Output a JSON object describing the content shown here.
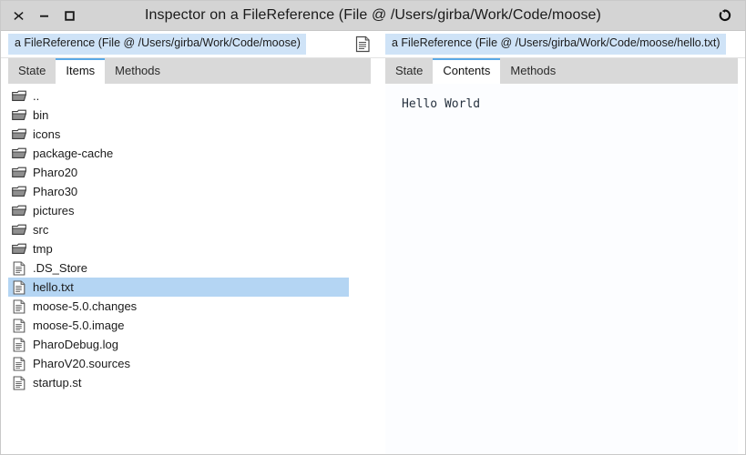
{
  "window": {
    "title": "Inspector on a FileReference (File @ /Users/girba/Work/Code/moose)",
    "controls": {
      "close_label": "✕",
      "minimize_label": "−",
      "maximize_label": "□",
      "close_icon": "close-icon",
      "minimize_icon": "minimize-icon",
      "maximize_icon": "maximize-icon",
      "history_icon": "refresh-history-icon"
    }
  },
  "breadcrumb": {
    "items": [
      {
        "label": "a FileReference (File @ /Users/girba/Work/Code/moose)"
      },
      {
        "label": "a FileReference (File @ /Users/girba/Work/Code/moose/hello.txt)"
      }
    ],
    "separator_icon": "document-icon"
  },
  "left_pane": {
    "tabs": [
      {
        "label": "State",
        "selected": false
      },
      {
        "label": "Items",
        "selected": true
      },
      {
        "label": "Methods",
        "selected": false
      }
    ],
    "items": [
      {
        "label": "..",
        "icon": "folder-icon",
        "type": "folder",
        "selected": false
      },
      {
        "label": "bin",
        "icon": "folder-icon",
        "type": "folder",
        "selected": false
      },
      {
        "label": "icons",
        "icon": "folder-icon",
        "type": "folder",
        "selected": false
      },
      {
        "label": "package-cache",
        "icon": "folder-icon",
        "type": "folder",
        "selected": false
      },
      {
        "label": "Pharo20",
        "icon": "folder-icon",
        "type": "folder",
        "selected": false
      },
      {
        "label": "Pharo30",
        "icon": "folder-icon",
        "type": "folder",
        "selected": false
      },
      {
        "label": "pictures",
        "icon": "folder-icon",
        "type": "folder",
        "selected": false
      },
      {
        "label": "src",
        "icon": "folder-icon",
        "type": "folder",
        "selected": false
      },
      {
        "label": "tmp",
        "icon": "folder-icon",
        "type": "folder",
        "selected": false
      },
      {
        "label": ".DS_Store",
        "icon": "file-icon",
        "type": "file",
        "selected": false
      },
      {
        "label": "hello.txt",
        "icon": "file-icon",
        "type": "file",
        "selected": true
      },
      {
        "label": "moose-5.0.changes",
        "icon": "file-icon",
        "type": "file",
        "selected": false
      },
      {
        "label": "moose-5.0.image",
        "icon": "file-icon",
        "type": "file",
        "selected": false
      },
      {
        "label": "PharoDebug.log",
        "icon": "file-icon",
        "type": "file",
        "selected": false
      },
      {
        "label": "PharoV20.sources",
        "icon": "file-icon",
        "type": "file",
        "selected": false
      },
      {
        "label": "startup.st",
        "icon": "file-icon",
        "type": "file",
        "selected": false
      }
    ]
  },
  "right_pane": {
    "tabs": [
      {
        "label": "State",
        "selected": false
      },
      {
        "label": "Contents",
        "selected": true
      },
      {
        "label": "Methods",
        "selected": false
      }
    ],
    "content": "Hello World"
  },
  "colors": {
    "titlebar": "#d4d4d4",
    "tabbar": "#d9d9d9",
    "tab_selected_accent": "#5aa9e6",
    "breadcrumb_highlight": "#cfe3f7",
    "row_selected": "#b4d5f3",
    "text": "#1b1b1b"
  }
}
